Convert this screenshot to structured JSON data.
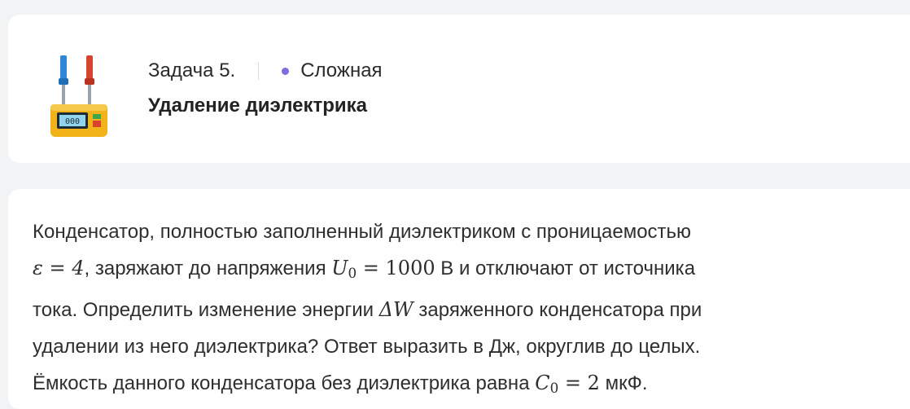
{
  "task_header": {
    "task_number": "Задача 5.",
    "difficulty": "Сложная",
    "difficulty_color": "#7b6fe0",
    "title": "Удаление диэлектрика",
    "icon": "multimeter-icon"
  },
  "problem": {
    "line1": "Конденсатор, полностью заполненный диэлектриком с проницаемостью",
    "line2_math_eps": "ε = 4",
    "line2_text_a": ", заряжают до напряжения ",
    "line2_math_u_var": "U",
    "line2_math_u_sub": "0",
    "line2_math_u_val": " = 1000",
    "line2_text_b": " В и отключают от источника",
    "line3_text_a": "тока. Определить изменение энергии ",
    "line3_math_dw": "ΔW",
    "line3_text_b": " заряженного конденсатора при",
    "line4": "удалении из него диэлектрика? Ответ выразить в Дж, округлив до целых.",
    "line5_text_a": "Ёмкость данного конденсатора без диэлектрика равна ",
    "line5_math_c_var": "C",
    "line5_math_c_sub": "0",
    "line5_math_c_val": " = 2",
    "line5_text_b": " мкФ."
  }
}
